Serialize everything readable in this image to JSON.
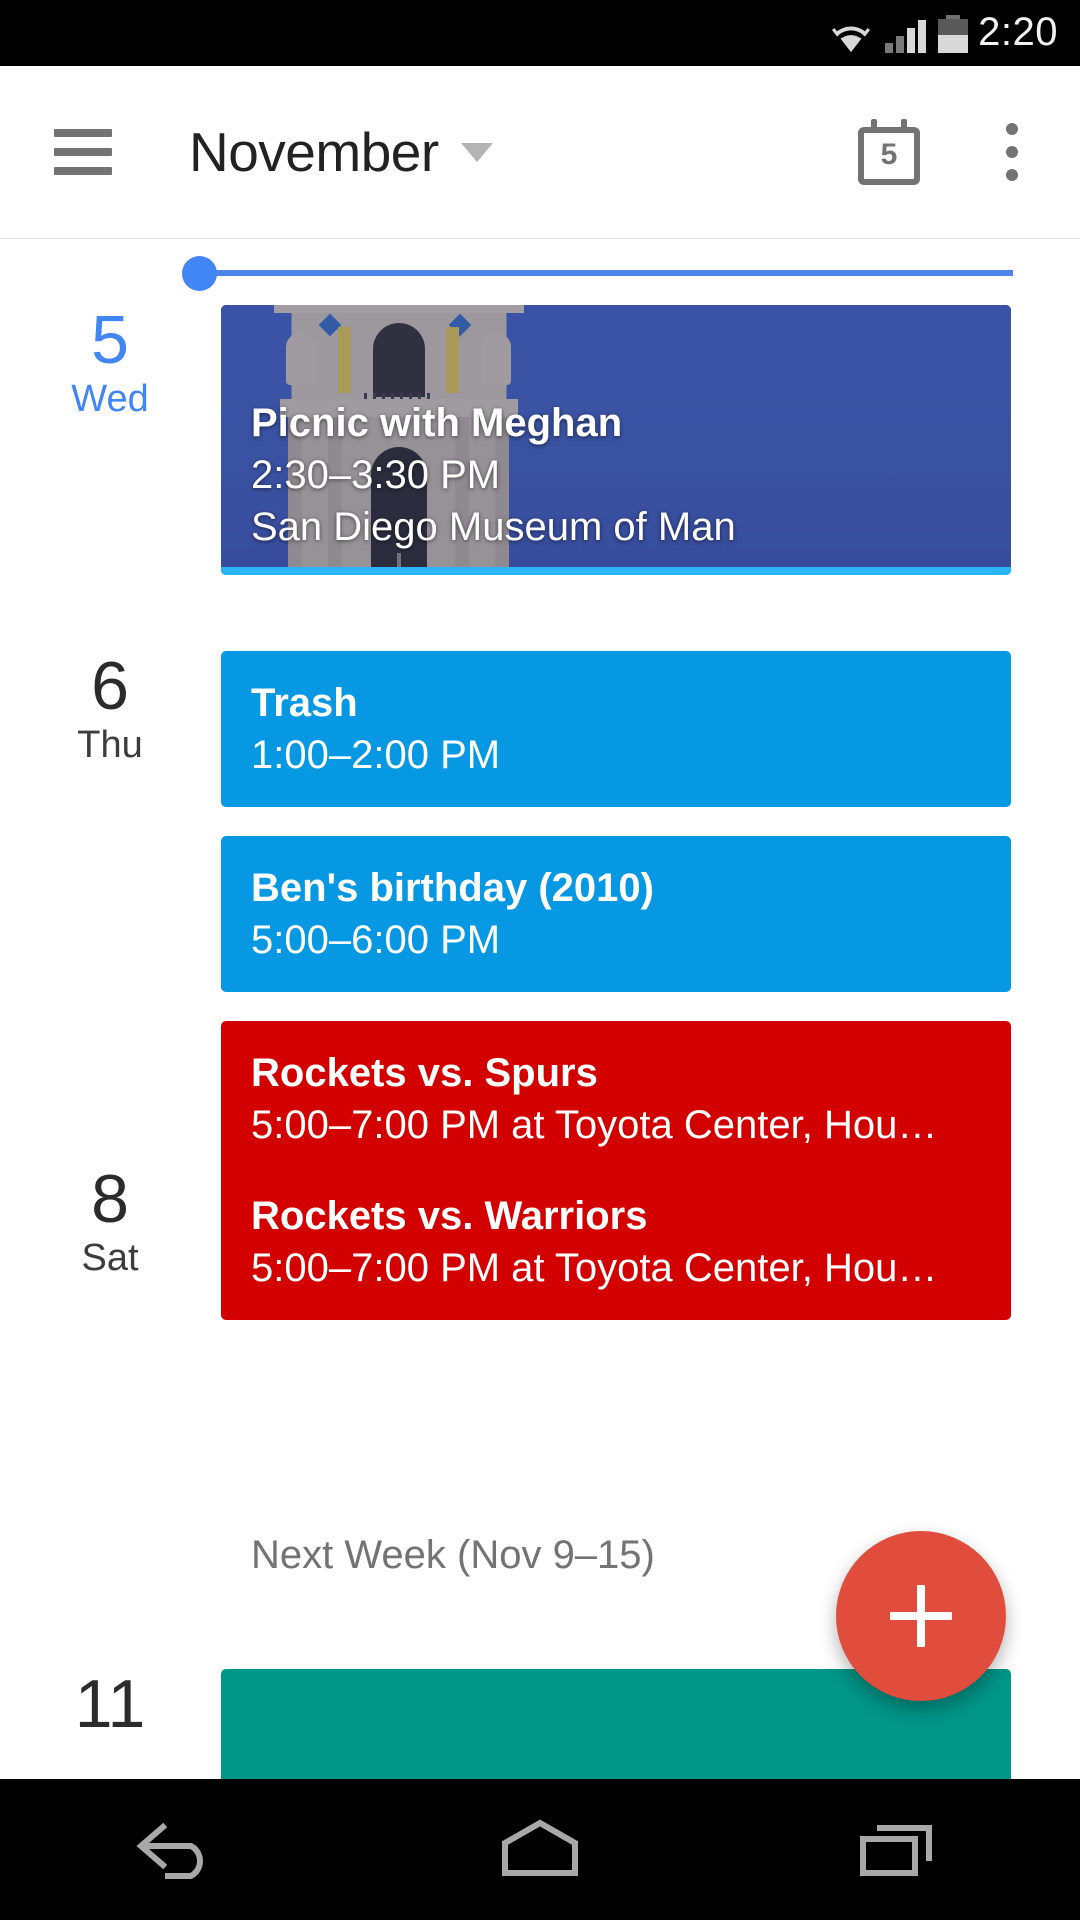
{
  "status_bar": {
    "time": "2:20",
    "icons": [
      "wifi-icon",
      "cellular-signal-icon",
      "battery-icon"
    ],
    "signal_bars_filled": 2,
    "signal_bars_total": 4,
    "battery_level_percent": 55
  },
  "app_bar": {
    "menu_icon": "hamburger-menu-icon",
    "title": "November",
    "dropdown_icon": "chevron-down-icon",
    "today_icon": "calendar-today-icon",
    "today_date_number": "5",
    "overflow_icon": "more-vertical-icon"
  },
  "colors": {
    "today_blue": "#4285f4",
    "event_blue": "#0698e3",
    "event_red": "#d30000",
    "event_teal": "#009688",
    "photo_overlay_blue": "#3a52a2",
    "fab_red": "#e04d3d",
    "muted_text": "#737373"
  },
  "agenda": {
    "now_indicator": "current-time-line",
    "days": [
      {
        "date_number": "5",
        "day_of_week": "Wed",
        "is_today": true,
        "events": [
          {
            "title": "Picnic with Meghan",
            "time": "2:30–3:30 PM",
            "location": "San Diego Museum of Man",
            "style": "photo",
            "photo_subject": "California Tower, San Diego Museum of Man"
          }
        ]
      },
      {
        "date_number": "6",
        "day_of_week": "Thu",
        "is_today": false,
        "events": [
          {
            "title": "Trash",
            "time": "1:00–2:00 PM",
            "location": "",
            "style": "blue"
          },
          {
            "title": "Ben's birthday (2010)",
            "time": "5:00–6:00 PM",
            "location": "",
            "style": "blue"
          },
          {
            "title": "Rockets vs. Spurs",
            "time": "5:00–7:00 PM at Toyota Center, Hou…",
            "location": "",
            "style": "red"
          }
        ]
      },
      {
        "date_number": "8",
        "day_of_week": "Sat",
        "is_today": false,
        "events": [
          {
            "title": "Rockets vs. Warriors",
            "time": "5:00–7:00 PM at Toyota Center, Hou…",
            "location": "",
            "style": "red"
          }
        ]
      }
    ],
    "section_header": "Next Week (Nov 9–15)",
    "partial_next_day": {
      "date_number": "11",
      "day_of_week": "",
      "event_style": "teal"
    }
  },
  "fab": {
    "icon": "plus-icon",
    "label": "Create event"
  },
  "nav_bar": {
    "back": "back-icon",
    "home": "home-icon",
    "recents": "recents-icon"
  }
}
